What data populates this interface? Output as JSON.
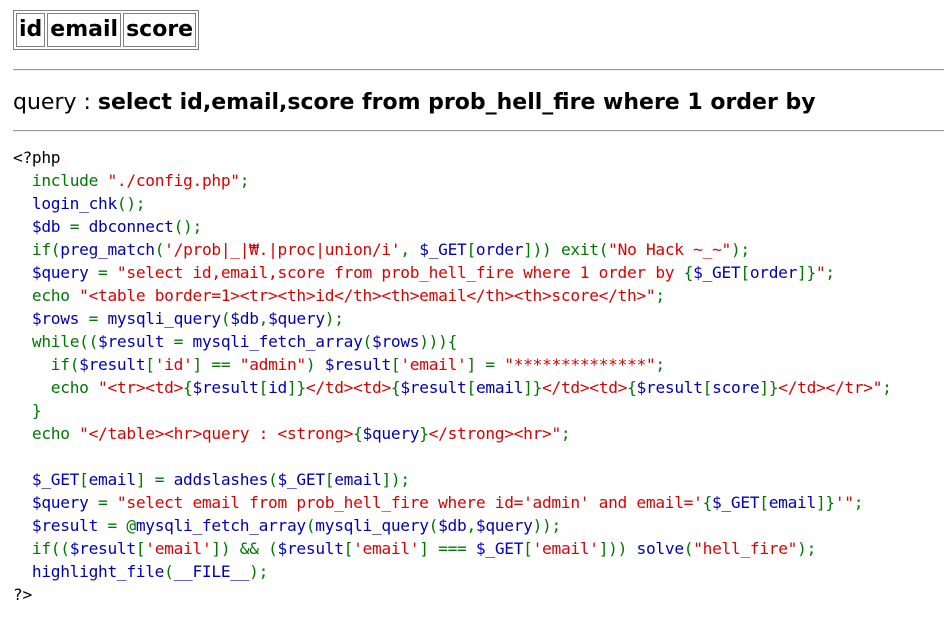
{
  "result_table": {
    "headers": [
      "id",
      "email",
      "score"
    ]
  },
  "query": {
    "label": "query : ",
    "sql": "select id,email,score from prob_hell_fire where 1 order by"
  },
  "colors": {
    "default": "#0000bb",
    "keyword": "#007700",
    "string": "#dd0000",
    "html": "#000000"
  },
  "source_code": [
    [
      [
        "html",
        "<?php"
      ]
    ],
    [
      [
        "default",
        "  "
      ],
      [
        "keyword",
        "include "
      ],
      [
        "string",
        "\"./config.php\""
      ],
      [
        "keyword",
        ";"
      ]
    ],
    [
      [
        "default",
        "  login_chk"
      ],
      [
        "keyword",
        "();"
      ]
    ],
    [
      [
        "default",
        "  $db "
      ],
      [
        "keyword",
        "= "
      ],
      [
        "default",
        "dbconnect"
      ],
      [
        "keyword",
        "();"
      ]
    ],
    [
      [
        "default",
        "  "
      ],
      [
        "keyword",
        "if("
      ],
      [
        "default",
        "preg_match"
      ],
      [
        "keyword",
        "("
      ],
      [
        "string",
        "'/prob|_|₩.|proc|union/i'"
      ],
      [
        "keyword",
        ", "
      ],
      [
        "default",
        "$_GET"
      ],
      [
        "keyword",
        "["
      ],
      [
        "default",
        "order"
      ],
      [
        "keyword",
        "])) exit("
      ],
      [
        "string",
        "\"No Hack ~_~\""
      ],
      [
        "keyword",
        ");"
      ]
    ],
    [
      [
        "default",
        "  $query "
      ],
      [
        "keyword",
        "= "
      ],
      [
        "string",
        "\"select id,email,score from prob_hell_fire where 1 order by "
      ],
      [
        "keyword",
        "{"
      ],
      [
        "default",
        "$_GET"
      ],
      [
        "keyword",
        "["
      ],
      [
        "default",
        "order"
      ],
      [
        "keyword",
        "]}"
      ],
      [
        "string",
        "\""
      ],
      [
        "keyword",
        ";"
      ]
    ],
    [
      [
        "default",
        "  "
      ],
      [
        "keyword",
        "echo "
      ],
      [
        "string",
        "\"<table border=1><tr><th>id</th><th>email</th><th>score</th>\""
      ],
      [
        "keyword",
        ";"
      ]
    ],
    [
      [
        "default",
        "  $rows "
      ],
      [
        "keyword",
        "= "
      ],
      [
        "default",
        "mysqli_query"
      ],
      [
        "keyword",
        "("
      ],
      [
        "default",
        "$db"
      ],
      [
        "keyword",
        ","
      ],
      [
        "default",
        "$query"
      ],
      [
        "keyword",
        ");"
      ]
    ],
    [
      [
        "default",
        "  "
      ],
      [
        "keyword",
        "while(("
      ],
      [
        "default",
        "$result "
      ],
      [
        "keyword",
        "= "
      ],
      [
        "default",
        "mysqli_fetch_array"
      ],
      [
        "keyword",
        "("
      ],
      [
        "default",
        "$rows"
      ],
      [
        "keyword",
        "))){"
      ]
    ],
    [
      [
        "default",
        "    "
      ],
      [
        "keyword",
        "if("
      ],
      [
        "default",
        "$result"
      ],
      [
        "keyword",
        "["
      ],
      [
        "string",
        "'id'"
      ],
      [
        "keyword",
        "] == "
      ],
      [
        "string",
        "\"admin\""
      ],
      [
        "keyword",
        ") "
      ],
      [
        "default",
        "$result"
      ],
      [
        "keyword",
        "["
      ],
      [
        "string",
        "'email'"
      ],
      [
        "keyword",
        "] = "
      ],
      [
        "string",
        "\"**************\""
      ],
      [
        "keyword",
        ";"
      ]
    ],
    [
      [
        "default",
        "    "
      ],
      [
        "keyword",
        "echo "
      ],
      [
        "string",
        "\"<tr><td>"
      ],
      [
        "keyword",
        "{"
      ],
      [
        "default",
        "$result"
      ],
      [
        "keyword",
        "["
      ],
      [
        "default",
        "id"
      ],
      [
        "keyword",
        "]}"
      ],
      [
        "string",
        "</td><td>"
      ],
      [
        "keyword",
        "{"
      ],
      [
        "default",
        "$result"
      ],
      [
        "keyword",
        "["
      ],
      [
        "default",
        "email"
      ],
      [
        "keyword",
        "]}"
      ],
      [
        "string",
        "</td><td>"
      ],
      [
        "keyword",
        "{"
      ],
      [
        "default",
        "$result"
      ],
      [
        "keyword",
        "["
      ],
      [
        "default",
        "score"
      ],
      [
        "keyword",
        "]}"
      ],
      [
        "string",
        "</td></tr>\""
      ],
      [
        "keyword",
        ";"
      ]
    ],
    [
      [
        "default",
        "  "
      ],
      [
        "keyword",
        "}"
      ]
    ],
    [
      [
        "default",
        "  "
      ],
      [
        "keyword",
        "echo "
      ],
      [
        "string",
        "\"</table><hr>query : <strong>"
      ],
      [
        "keyword",
        "{"
      ],
      [
        "default",
        "$query"
      ],
      [
        "keyword",
        "}"
      ],
      [
        "string",
        "</strong><hr>\""
      ],
      [
        "keyword",
        ";"
      ]
    ],
    [
      [
        "default",
        ""
      ]
    ],
    [
      [
        "default",
        "  $_GET"
      ],
      [
        "keyword",
        "["
      ],
      [
        "default",
        "email"
      ],
      [
        "keyword",
        "] = "
      ],
      [
        "default",
        "addslashes"
      ],
      [
        "keyword",
        "("
      ],
      [
        "default",
        "$_GET"
      ],
      [
        "keyword",
        "["
      ],
      [
        "default",
        "email"
      ],
      [
        "keyword",
        "]);"
      ]
    ],
    [
      [
        "default",
        "  $query "
      ],
      [
        "keyword",
        "= "
      ],
      [
        "string",
        "\"select email from prob_hell_fire where id='admin' and email='"
      ],
      [
        "keyword",
        "{"
      ],
      [
        "default",
        "$_GET"
      ],
      [
        "keyword",
        "["
      ],
      [
        "default",
        "email"
      ],
      [
        "keyword",
        "]}"
      ],
      [
        "string",
        "'\""
      ],
      [
        "keyword",
        ";"
      ]
    ],
    [
      [
        "default",
        "  $result "
      ],
      [
        "keyword",
        "= @"
      ],
      [
        "default",
        "mysqli_fetch_array"
      ],
      [
        "keyword",
        "("
      ],
      [
        "default",
        "mysqli_query"
      ],
      [
        "keyword",
        "("
      ],
      [
        "default",
        "$db"
      ],
      [
        "keyword",
        ","
      ],
      [
        "default",
        "$query"
      ],
      [
        "keyword",
        "));"
      ]
    ],
    [
      [
        "default",
        "  "
      ],
      [
        "keyword",
        "if(("
      ],
      [
        "default",
        "$result"
      ],
      [
        "keyword",
        "["
      ],
      [
        "string",
        "'email'"
      ],
      [
        "keyword",
        "]) && ("
      ],
      [
        "default",
        "$result"
      ],
      [
        "keyword",
        "["
      ],
      [
        "string",
        "'email'"
      ],
      [
        "keyword",
        "] === "
      ],
      [
        "default",
        "$_GET"
      ],
      [
        "keyword",
        "["
      ],
      [
        "string",
        "'email'"
      ],
      [
        "keyword",
        "])) "
      ],
      [
        "default",
        "solve"
      ],
      [
        "keyword",
        "("
      ],
      [
        "string",
        "\"hell_fire\""
      ],
      [
        "keyword",
        ");"
      ]
    ],
    [
      [
        "default",
        "  highlight_file"
      ],
      [
        "keyword",
        "("
      ],
      [
        "default",
        "__FILE__"
      ],
      [
        "keyword",
        ");"
      ]
    ],
    [
      [
        "html",
        "?>"
      ]
    ]
  ]
}
